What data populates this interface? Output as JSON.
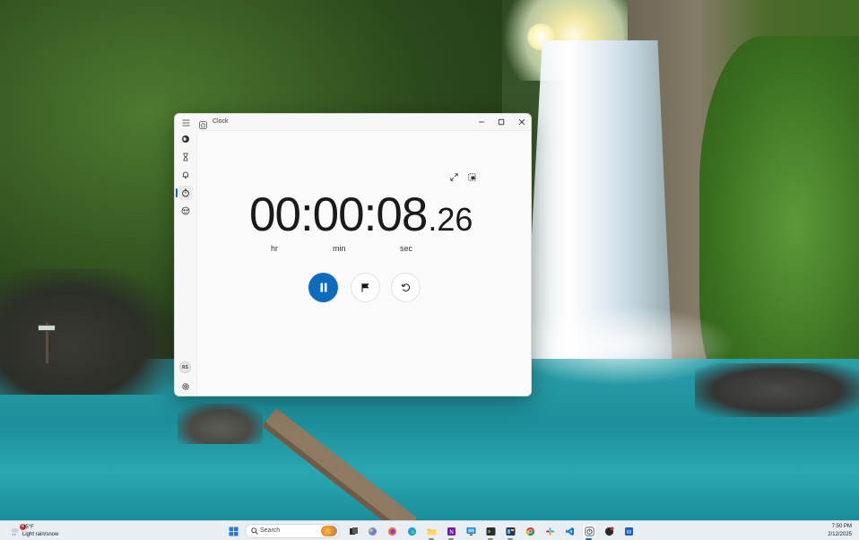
{
  "window": {
    "app_title": "Clock",
    "minimize_icon": "minimize-icon",
    "maximize_icon": "maximize-icon",
    "close_icon": "close-icon"
  },
  "nav": {
    "items": [
      {
        "name": "menu",
        "icon": "hamburger-icon"
      },
      {
        "name": "world-clock",
        "icon": "globe-icon"
      },
      {
        "name": "timer",
        "icon": "hourglass-icon"
      },
      {
        "name": "alarm",
        "icon": "bell-icon"
      },
      {
        "name": "stopwatch",
        "icon": "stopwatch-icon",
        "active": true
      },
      {
        "name": "focus-sessions",
        "icon": "focus-icon"
      }
    ],
    "avatar_initials": "RS",
    "settings_icon": "gear-icon"
  },
  "stopwatch": {
    "time_main": "00:00:08",
    "time_fraction": ".26",
    "unit_hr": "hr",
    "unit_min": "min",
    "unit_sec": "sec",
    "state": "running"
  },
  "taskbar": {
    "weather_temp": "35°F",
    "weather_condition": "Light rain/snow",
    "weather_badge": "4",
    "search_placeholder": "Search",
    "time": "7:50 PM",
    "date": "2/12/2025",
    "colors": {
      "accent": "#0f6cbd",
      "pause_button": "#0f6cbd"
    }
  }
}
